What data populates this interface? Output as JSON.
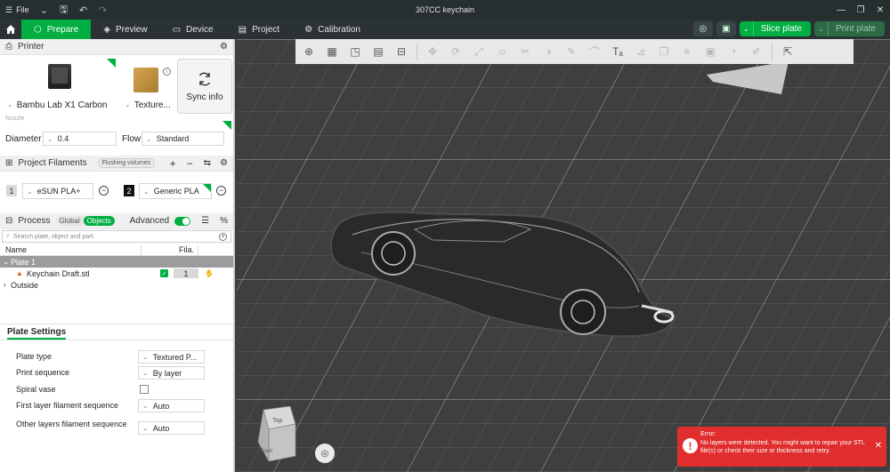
{
  "titlebar": {
    "file_label": "File",
    "title": "307CC keychain"
  },
  "tabs": [
    {
      "label": "Prepare",
      "active": true
    },
    {
      "label": "Preview"
    },
    {
      "label": "Device"
    },
    {
      "label": "Project"
    },
    {
      "label": "Calibration"
    }
  ],
  "actions": {
    "slice_label": "Slice plate",
    "print_label": "Print plate"
  },
  "printer": {
    "section_title": "Printer",
    "printer_name": "Bambu Lab X1 Carbon",
    "plate_name": "Texture...",
    "sync_label": "Sync info",
    "nozzle_label": "Nozzle",
    "diameter_label": "Diameter",
    "diameter_value": "0.4",
    "flow_label": "Flow",
    "flow_value": "Standard"
  },
  "filaments": {
    "section_title": "Project Filaments",
    "flushing_label": "Flushing volumes",
    "items": [
      {
        "index": "1",
        "name": "eSUN PLA+",
        "color": "#d9d9d9"
      },
      {
        "index": "2",
        "name": "Generic PLA",
        "color": "#111111"
      }
    ]
  },
  "process": {
    "section_title": "Process",
    "global_label": "Global",
    "objects_label": "Objects",
    "advanced_label": "Advanced",
    "search_placeholder": "Search plate, object and part."
  },
  "object_list": {
    "col_name": "Name",
    "col_fila": "Fila.",
    "plate_label": "Plate 1",
    "object_name": "Keychain Draft.stl",
    "object_fila": "1",
    "outside_label": "Outside"
  },
  "plate_settings": {
    "title": "Plate Settings",
    "rows": [
      {
        "label": "Plate type",
        "value": "Textured P..."
      },
      {
        "label": "Print sequence",
        "value": "By layer"
      },
      {
        "label": "Spiral vase",
        "value": ""
      },
      {
        "label": "First layer filament sequence",
        "value": "Auto"
      },
      {
        "label": "Other layers filament sequence",
        "value": "Auto"
      }
    ]
  },
  "viewport": {
    "navcube_top": "Top",
    "navcube_front": "Front"
  },
  "error": {
    "title": "Error:",
    "message": "No layers were detected. You might want to repair your STL file(s) or check their size or thickness and retry."
  },
  "colors": {
    "accent": "#00ae42",
    "error": "#e02d2d",
    "bed": "#404040"
  }
}
